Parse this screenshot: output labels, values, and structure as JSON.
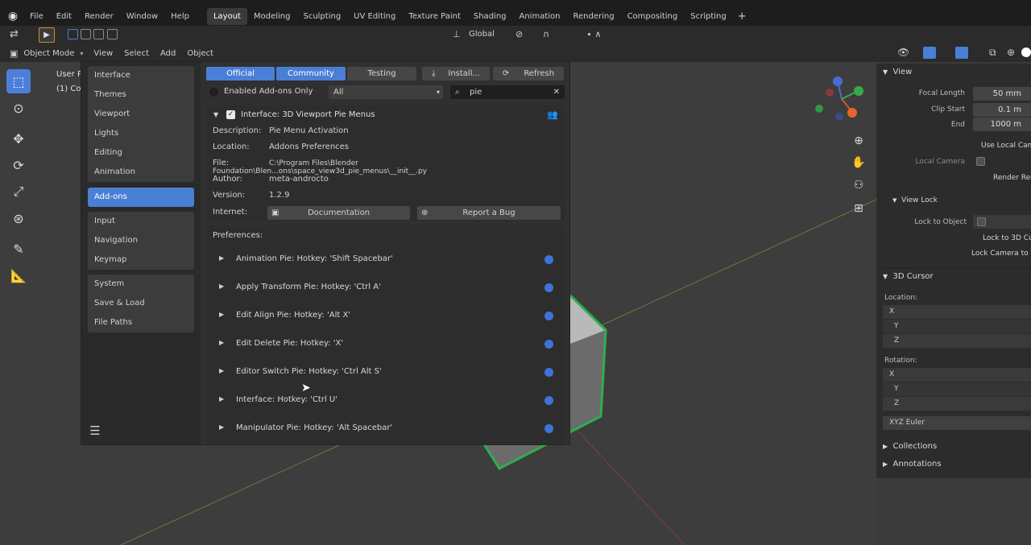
{
  "menu": {
    "items": [
      "File",
      "Edit",
      "Render",
      "Window",
      "Help"
    ],
    "workspaces": [
      "Layout",
      "Modeling",
      "Sculpting",
      "UV Editing",
      "Texture Paint",
      "Shading",
      "Animation",
      "Rendering",
      "Compositing",
      "Scripting"
    ],
    "active_workspace": "Layout",
    "add_tab": "+"
  },
  "toolrow": {
    "orientation": "Global"
  },
  "header": {
    "mode": "Object Mode",
    "view": "View",
    "select": "Select",
    "add": "Add",
    "object": "Object"
  },
  "viewport": {
    "overlay_line1": "User P",
    "overlay_line2": "(1) Col"
  },
  "prefs": {
    "nav": {
      "group1": [
        "Interface",
        "Themes",
        "Viewport",
        "Lights",
        "Editing",
        "Animation"
      ],
      "active": "Add-ons",
      "group2": [
        "Input",
        "Navigation",
        "Keymap"
      ],
      "group3": [
        "System",
        "Save & Load",
        "File Paths"
      ]
    },
    "tabs": {
      "official": "Official",
      "community": "Community",
      "testing": "Testing",
      "install": "Install...",
      "refresh": "Refresh"
    },
    "filter": {
      "enabled_only": "Enabled Add-ons Only",
      "category": "All",
      "search": "pie"
    },
    "addon": {
      "title": "Interface: 3D Viewport Pie Menus",
      "description_key": "Description:",
      "description": "Pie Menu Activation",
      "location_key": "Location:",
      "location": "Addons Preferences",
      "file_key": "File:",
      "file": "C:\\Program Files\\Blender Foundation\\Blen...ons\\space_view3d_pie_menus\\__init__.py",
      "author_key": "Author:",
      "author": "meta-androcto",
      "version_key": "Version:",
      "version": "1.2.9",
      "internet_key": "Internet:",
      "documentation": "Documentation",
      "report_bug": "Report a Bug"
    },
    "preferences_label": "Preferences:",
    "pies": [
      "Animation Pie: Hotkey: 'Shift Spacebar'",
      "Apply Transform Pie: Hotkey: 'Ctrl A'",
      "Edit Align Pie: Hotkey: 'Alt X'",
      "Edit Delete Pie: Hotkey: 'X'",
      "Editor Switch Pie: Hotkey: 'Ctrl Alt S'",
      "Interface: Hotkey: 'Ctrl U'",
      "Manipulator Pie: Hotkey: 'Alt Spacebar'"
    ]
  },
  "sidebar": {
    "view_header": "View",
    "focal_length_label": "Focal Length",
    "focal_length": "50 mm",
    "clip_start_label": "Clip Start",
    "clip_start": "0.1 m",
    "end_label": "End",
    "end": "1000 m",
    "use_local_camera": "Use Local Cam",
    "local_camera_label": "Local Camera",
    "render_region": "Render Reg",
    "view_lock_header": "View Lock",
    "lock_to_object_label": "Lock to Object",
    "lock_to_3d_cursor": "Lock to 3D Cu",
    "lock_camera": "Lock Camera to V",
    "cursor_header": "3D Cursor",
    "location_label": "Location:",
    "rotation_label": "Rotation:",
    "axes": [
      "X",
      "Y",
      "Z"
    ],
    "rotation_mode": "XYZ Euler",
    "collections": "Collections",
    "annotations": "Annotations"
  },
  "colors": {
    "accent": "#4a7fd6",
    "pie_dot": "#3f74d6",
    "selection_outline": "#2fae4f"
  }
}
